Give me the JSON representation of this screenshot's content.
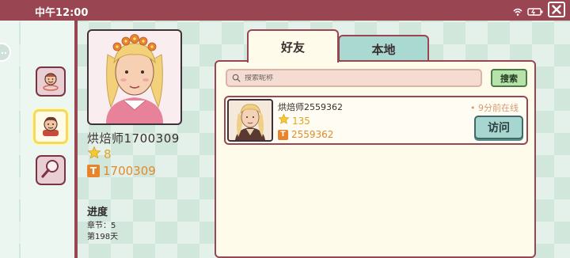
{
  "status_bar": {
    "time": "中午12:00",
    "icons": [
      "wifi-icon",
      "battery-icon"
    ],
    "close_icon": "close-icon"
  },
  "nav": {
    "items": [
      "chef-icon",
      "profile-icon",
      "magnifier-icon"
    ],
    "active_index": 1
  },
  "profile": {
    "name": "烘焙师1700309",
    "stars": "8",
    "id_badge": "T",
    "id": "1700309",
    "progress_title": "进度",
    "chapter": "章节：5",
    "day": "第198天"
  },
  "tabs": [
    {
      "label": "好友",
      "active": true
    },
    {
      "label": "本地",
      "active": false
    }
  ],
  "search": {
    "placeholder": "搜索昵称",
    "value": "",
    "button_label": "搜索"
  },
  "friends": [
    {
      "name": "烘焙师2559362",
      "stars": "135",
      "id_badge": "T",
      "id": "2559362",
      "status": "• 9分前在线",
      "visit_label": "访问"
    }
  ],
  "colors": {
    "accent": "#9a4552",
    "panel_bg": "#fffbea",
    "tab_inactive": "#aad9d1",
    "search_button": "#b5e3a9",
    "visit_button": "#a6d6cf",
    "star": "#e0a424",
    "id_orange": "#e18a2a"
  }
}
